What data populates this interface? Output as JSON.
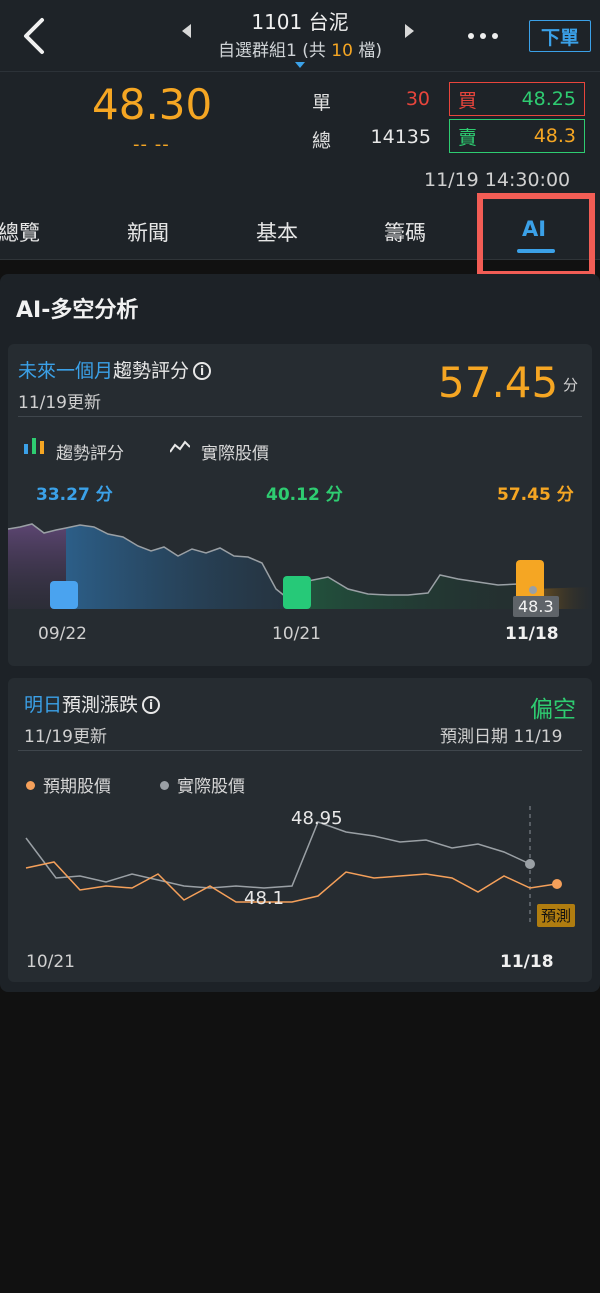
{
  "header": {
    "stock_title": "1101 台泥",
    "group_prefix": "自選群組1 (共 ",
    "group_count": "10",
    "group_suffix": " 檔)",
    "order_label": "下單"
  },
  "quote": {
    "price": "48.30",
    "change": "-- --",
    "single_label": "單",
    "single_value": "30",
    "total_label": "總",
    "total_value": "14135",
    "buy_label": "買",
    "buy_price": "48.25",
    "sell_label": "賣",
    "sell_price": "48.3",
    "timestamp": "11/19 14:30:00"
  },
  "tabs": [
    {
      "label": "總覽"
    },
    {
      "label": "新聞"
    },
    {
      "label": "基本"
    },
    {
      "label": "籌碼"
    },
    {
      "label": "AI",
      "active": true
    }
  ],
  "ai_panel": {
    "title": "AI-多空分析",
    "trend_card": {
      "heading_blue": "未來一個月",
      "heading_rest": "趨勢評分",
      "updated": "11/19更新",
      "score": "57.45",
      "score_unit": "分",
      "legend_score": "趨勢評分",
      "legend_price": "實際股價",
      "scores": [
        "33.27 分",
        "40.12 分",
        "57.45 分"
      ],
      "tooltip": "48.3",
      "x_labels": [
        "09/22",
        "10/21",
        "11/18"
      ]
    },
    "forecast_card": {
      "heading_blue": "明日",
      "heading_rest": "預測漲跌",
      "updated": "11/19更新",
      "bias": "偏空",
      "forecast_date": "預測日期 11/19",
      "legend_expected": "預期股價",
      "legend_actual": "實際股價",
      "high_label": "48.95",
      "low_label": "48.1",
      "predict_tag": "預測",
      "x_labels": [
        "10/21",
        "11/18"
      ]
    }
  },
  "colors": {
    "accent_blue": "#3ba1e8",
    "orange": "#f5a623",
    "green": "#2ecc71",
    "red": "#e8453c",
    "highlight": "#f25d55"
  }
}
